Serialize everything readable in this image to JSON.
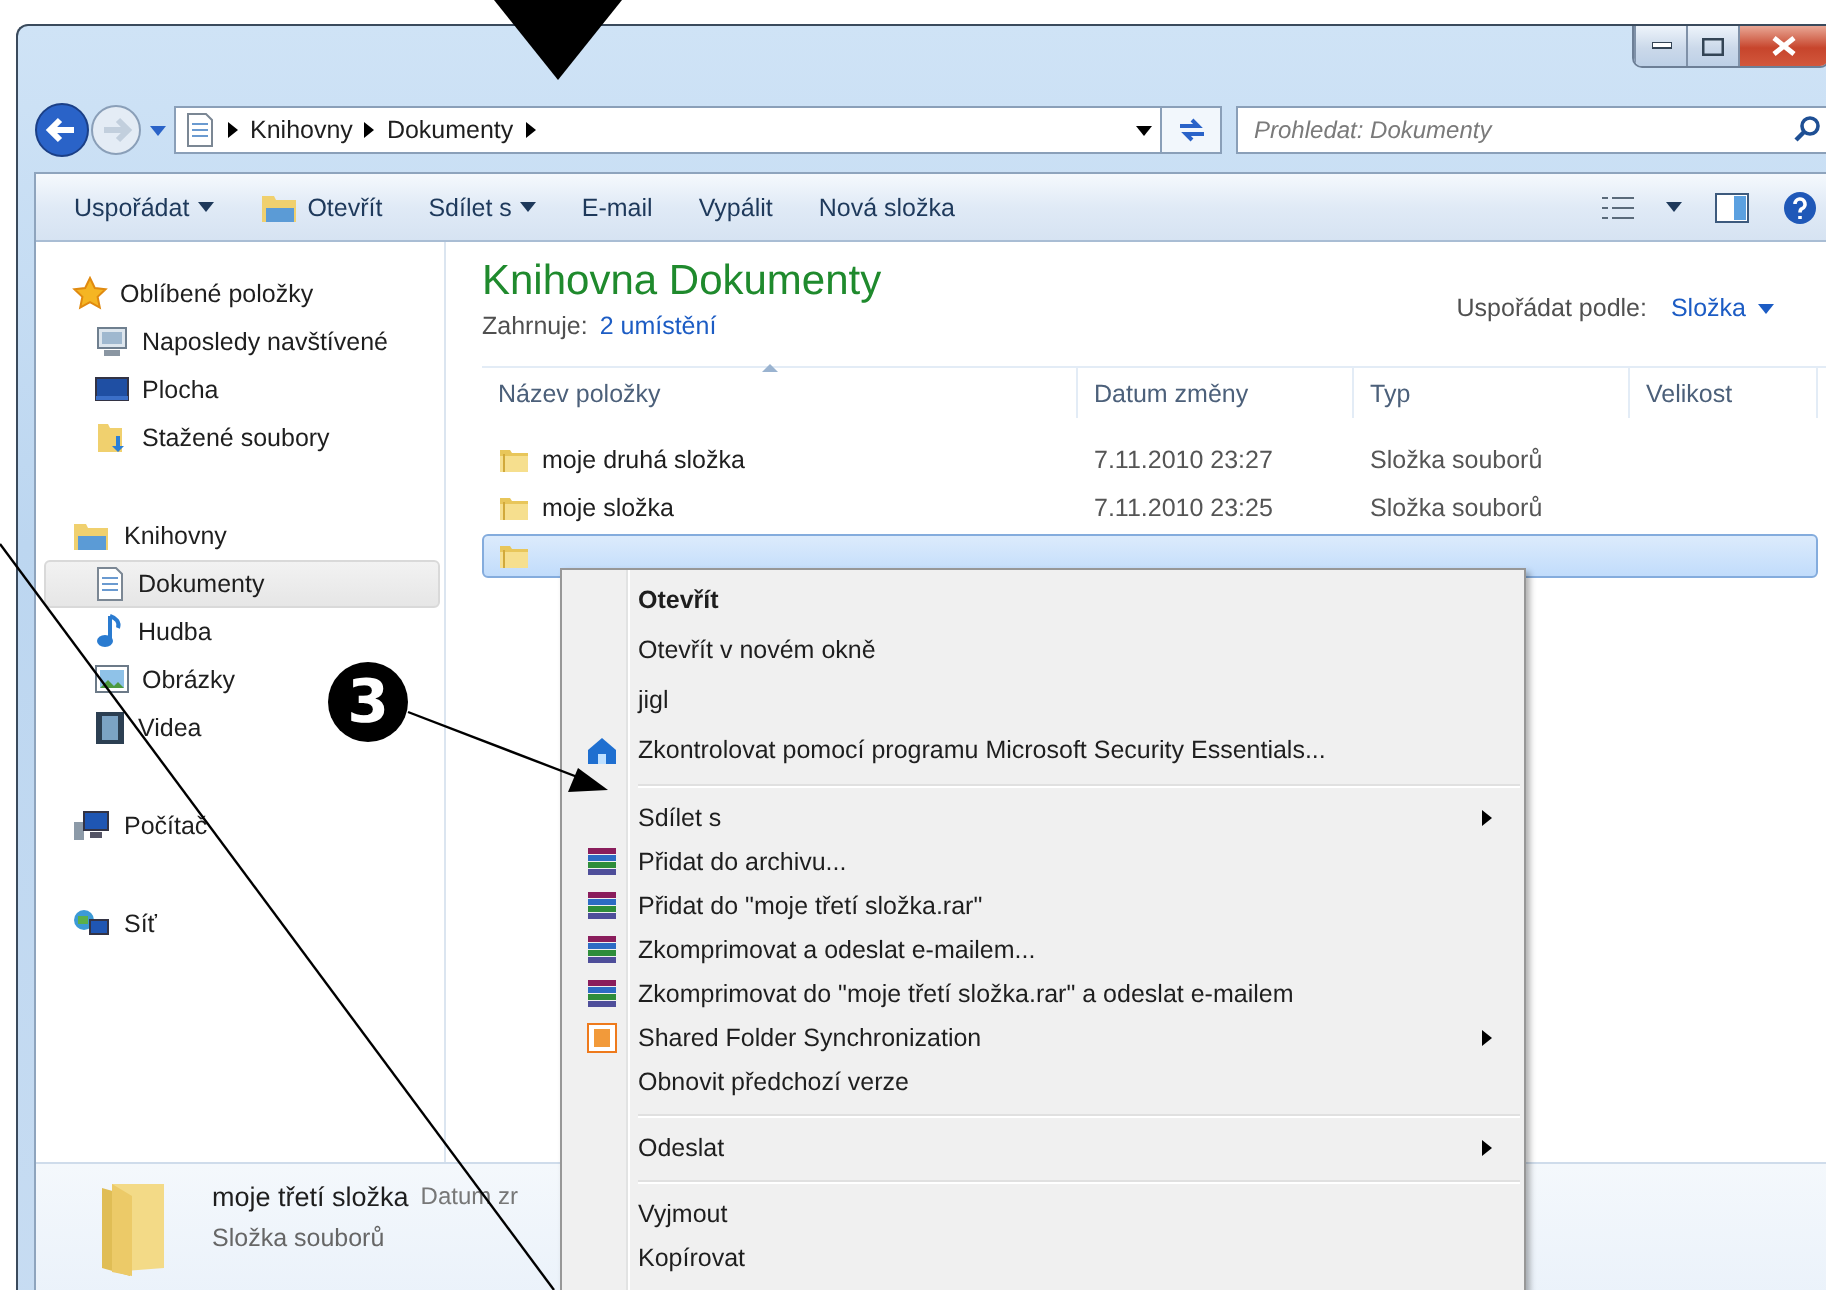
{
  "address_bar": {
    "path": [
      "Knihovny",
      "Dokumenty"
    ]
  },
  "search": {
    "placeholder": "Prohledat: Dokumenty"
  },
  "toolbar": {
    "buttons": [
      {
        "label": "Uspořádat",
        "dropdown": true,
        "kind": "plain"
      },
      {
        "label": "Otevřít",
        "dropdown": false,
        "kind": "open"
      },
      {
        "label": "Sdílet s",
        "dropdown": true,
        "kind": "plain"
      },
      {
        "label": "E-mail",
        "dropdown": false,
        "kind": "plain"
      },
      {
        "label": "Vypálit",
        "dropdown": false,
        "kind": "plain"
      },
      {
        "label": "Nová složka",
        "dropdown": false,
        "kind": "plain"
      }
    ]
  },
  "sidebar": {
    "groups": [
      {
        "label": "Oblíbené položky",
        "kind": "star",
        "children": [
          {
            "label": "Naposledy navštívené",
            "kind": "recent",
            "selected": false
          },
          {
            "label": "Plocha",
            "kind": "desktop",
            "selected": false
          },
          {
            "label": "Stažené soubory",
            "kind": "download",
            "selected": false
          }
        ]
      },
      {
        "label": "Knihovny",
        "kind": "library",
        "children": [
          {
            "label": "Dokumenty",
            "kind": "document",
            "selected": true
          },
          {
            "label": "Hudba",
            "kind": "music",
            "selected": false
          },
          {
            "label": "Obrázky",
            "kind": "image",
            "selected": false
          },
          {
            "label": "Videa",
            "kind": "video",
            "selected": false
          }
        ]
      },
      {
        "label": "Počítač",
        "kind": "computer"
      },
      {
        "label": "Síť",
        "kind": "network"
      }
    ]
  },
  "library": {
    "title": "Knihovna Dokumenty",
    "includes_label": "Zahrnuje:",
    "includes_link": "2 umístění",
    "arrange_label": "Uspořádat podle:",
    "arrange_value": "Složka"
  },
  "table": {
    "columns": [
      "Název položky",
      "Datum změny",
      "Typ",
      "Velikost"
    ],
    "rows": [
      {
        "name": "moje druhá složka",
        "date": "7.11.2010 23:27",
        "type": "Složka souborů",
        "selected": false
      },
      {
        "name": "moje složka",
        "date": "7.11.2010 23:25",
        "type": "Složka souborů",
        "selected": false
      },
      {
        "selected": true
      }
    ]
  },
  "context_menu": {
    "items": [
      {
        "kind": "item",
        "label": "Otevřít",
        "bold": true,
        "submenu": false
      },
      {
        "kind": "item",
        "label": "Otevřít v novém okně",
        "bold": false,
        "submenu": false
      },
      {
        "kind": "item",
        "label": "jigl",
        "bold": false,
        "submenu": false
      },
      {
        "kind": "scan",
        "label": "Zkontrolovat pomocí programu Microsoft Security Essentials...",
        "bold": false,
        "submenu": false
      },
      {
        "kind": "separator"
      },
      {
        "kind": "item",
        "label": "Sdílet s",
        "bold": false,
        "submenu": true
      },
      {
        "kind": "archive",
        "label": "Přidat do archivu...",
        "bold": false,
        "submenu": false
      },
      {
        "kind": "archive",
        "label": "Přidat do \"moje třetí složka.rar\"",
        "bold": false,
        "submenu": false
      },
      {
        "kind": "archive",
        "label": "Zkomprimovat a odeslat e-mailem...",
        "bold": false,
        "submenu": false
      },
      {
        "kind": "archive",
        "label": "Zkomprimovat do \"moje třetí složka.rar\" a odeslat e-mailem",
        "bold": false,
        "submenu": false
      },
      {
        "kind": "sync",
        "label": "Shared Folder Synchronization",
        "bold": false,
        "submenu": true
      },
      {
        "kind": "item",
        "label": "Obnovit předchozí verze",
        "bold": false,
        "submenu": false
      },
      {
        "kind": "separator"
      },
      {
        "kind": "item",
        "label": "Odeslat",
        "bold": false,
        "submenu": true
      },
      {
        "kind": "separator"
      },
      {
        "kind": "item",
        "label": "Vyjmout",
        "bold": false,
        "submenu": false
      },
      {
        "kind": "item",
        "label": "Kopírovat",
        "bold": false,
        "submenu": false
      }
    ]
  },
  "details": {
    "name": "moje třetí složka",
    "field_label": "Datum zr",
    "type": "Složka souborů"
  },
  "callout": "3"
}
